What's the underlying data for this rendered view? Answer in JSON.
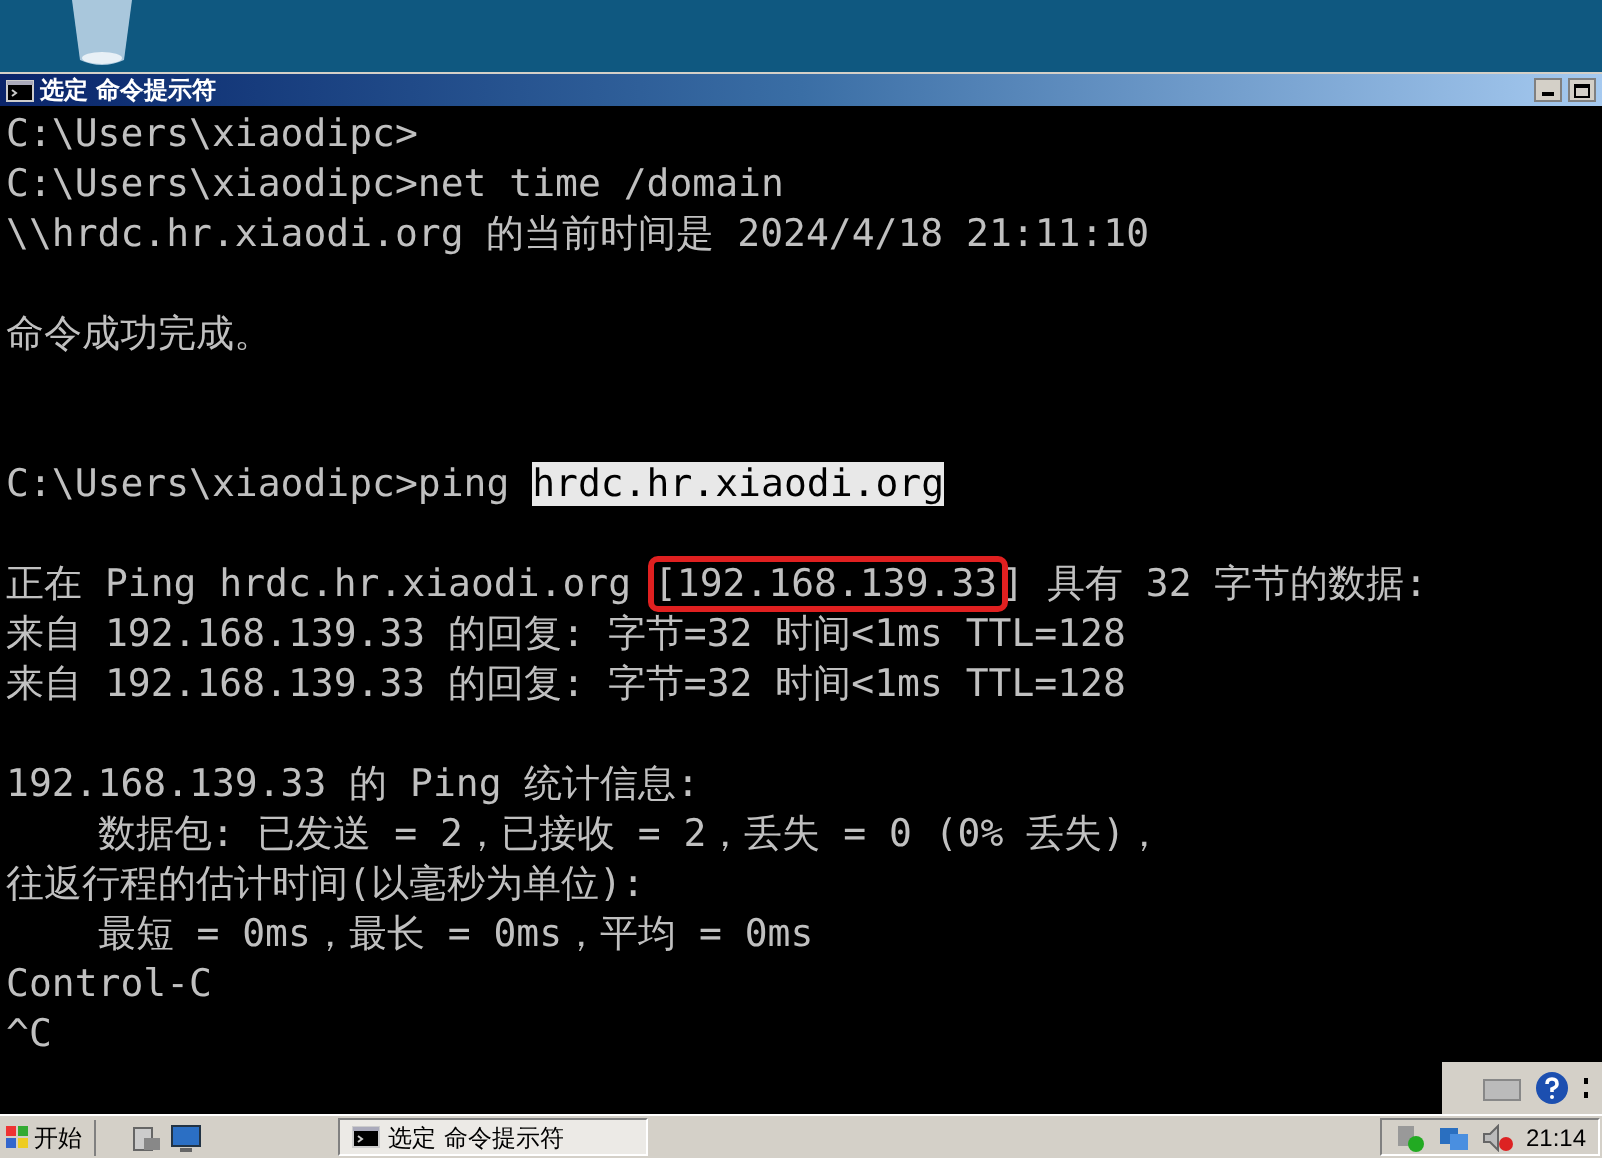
{
  "window": {
    "title": "选定 命令提示符"
  },
  "console": {
    "lines": [
      {
        "kind": "text",
        "segments": [
          {
            "kind": "plain",
            "text": "C:\\Users\\xiaodipc>"
          }
        ]
      },
      {
        "kind": "text",
        "segments": [
          {
            "kind": "plain",
            "text": "C:\\Users\\xiaodipc>net time /domain"
          }
        ]
      },
      {
        "kind": "text",
        "segments": [
          {
            "kind": "plain",
            "text": "\\\\hrdc.hr.xiaodi.org 的当前时间是 2024/4/18 21:11:10"
          }
        ]
      },
      {
        "kind": "blank"
      },
      {
        "kind": "text",
        "segments": [
          {
            "kind": "plain",
            "text": "命令成功完成。"
          }
        ]
      },
      {
        "kind": "blank"
      },
      {
        "kind": "blank"
      },
      {
        "kind": "text",
        "segments": [
          {
            "kind": "plain",
            "text": "C:\\Users\\xiaodipc>ping "
          },
          {
            "kind": "selected",
            "text": "hrdc.hr.xiaodi.org"
          }
        ]
      },
      {
        "kind": "blank"
      },
      {
        "kind": "text",
        "segments": [
          {
            "kind": "plain",
            "text": "正在 Ping hrdc.hr.xiaodi.org "
          },
          {
            "kind": "boxed",
            "text": "[192.168.139.33"
          },
          {
            "kind": "plain",
            "text": "] 具有 32 字节的数据:"
          }
        ]
      },
      {
        "kind": "text",
        "segments": [
          {
            "kind": "plain",
            "text": "来自 192.168.139.33 的回复: 字节=32 时间<1ms TTL=128"
          }
        ]
      },
      {
        "kind": "text",
        "segments": [
          {
            "kind": "plain",
            "text": "来自 192.168.139.33 的回复: 字节=32 时间<1ms TTL=128"
          }
        ]
      },
      {
        "kind": "blank"
      },
      {
        "kind": "text",
        "segments": [
          {
            "kind": "plain",
            "text": "192.168.139.33 的 Ping 统计信息:"
          }
        ]
      },
      {
        "kind": "text",
        "segments": [
          {
            "kind": "plain",
            "text": "    数据包: 已发送 = 2，已接收 = 2，丢失 = 0 (0% 丢失)，"
          }
        ]
      },
      {
        "kind": "text",
        "segments": [
          {
            "kind": "plain",
            "text": "往返行程的估计时间(以毫秒为单位):"
          }
        ]
      },
      {
        "kind": "text",
        "segments": [
          {
            "kind": "plain",
            "text": "    最短 = 0ms，最长 = 0ms，平均 = 0ms"
          }
        ]
      },
      {
        "kind": "text",
        "segments": [
          {
            "kind": "plain",
            "text": "Control-C"
          }
        ]
      },
      {
        "kind": "text",
        "segments": [
          {
            "kind": "plain",
            "text": "^C"
          }
        ]
      }
    ]
  },
  "taskbar": {
    "start": "开始",
    "tasks": [
      {
        "label": "选定 命令提示符",
        "selected": true
      }
    ],
    "clock": "21:14"
  }
}
